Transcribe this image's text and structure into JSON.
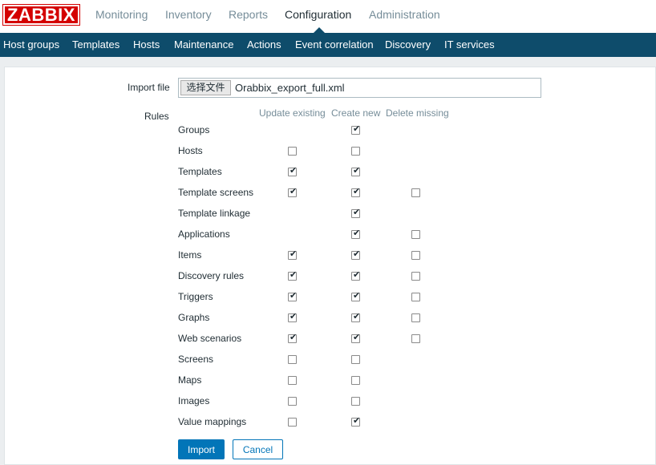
{
  "logo": "ZABBIX",
  "mainnav": [
    "Monitoring",
    "Inventory",
    "Reports",
    "Configuration",
    "Administration"
  ],
  "subnav": [
    "Host groups",
    "Templates",
    "Hosts",
    "Maintenance",
    "Actions",
    "Event correlation",
    "Discovery",
    "IT services"
  ],
  "form": {
    "import_file_label": "Import file",
    "file_button_label": "选择文件",
    "file_name": "Orabbix_export_full.xml",
    "rules_label": "Rules",
    "columns": [
      "Update existing",
      "Create new",
      "Delete missing"
    ],
    "rules": [
      {
        "name": "Groups",
        "update": null,
        "create": true,
        "delete": null
      },
      {
        "name": "Hosts",
        "update": false,
        "create": false,
        "delete": null
      },
      {
        "name": "Templates",
        "update": true,
        "create": true,
        "delete": null
      },
      {
        "name": "Template screens",
        "update": true,
        "create": true,
        "delete": false
      },
      {
        "name": "Template linkage",
        "update": null,
        "create": true,
        "delete": null
      },
      {
        "name": "Applications",
        "update": null,
        "create": true,
        "delete": false
      },
      {
        "name": "Items",
        "update": true,
        "create": true,
        "delete": false
      },
      {
        "name": "Discovery rules",
        "update": true,
        "create": true,
        "delete": false
      },
      {
        "name": "Triggers",
        "update": true,
        "create": true,
        "delete": false
      },
      {
        "name": "Graphs",
        "update": true,
        "create": true,
        "delete": false
      },
      {
        "name": "Web scenarios",
        "update": true,
        "create": true,
        "delete": false
      },
      {
        "name": "Screens",
        "update": false,
        "create": false,
        "delete": null
      },
      {
        "name": "Maps",
        "update": false,
        "create": false,
        "delete": null
      },
      {
        "name": "Images",
        "update": false,
        "create": false,
        "delete": null
      },
      {
        "name": "Value mappings",
        "update": false,
        "create": true,
        "delete": null
      }
    ],
    "import_button": "Import",
    "cancel_button": "Cancel"
  },
  "colors": {
    "brand_red": "#d40000",
    "nav_blue": "#0e4c6b",
    "primary_button": "#0275b8"
  }
}
